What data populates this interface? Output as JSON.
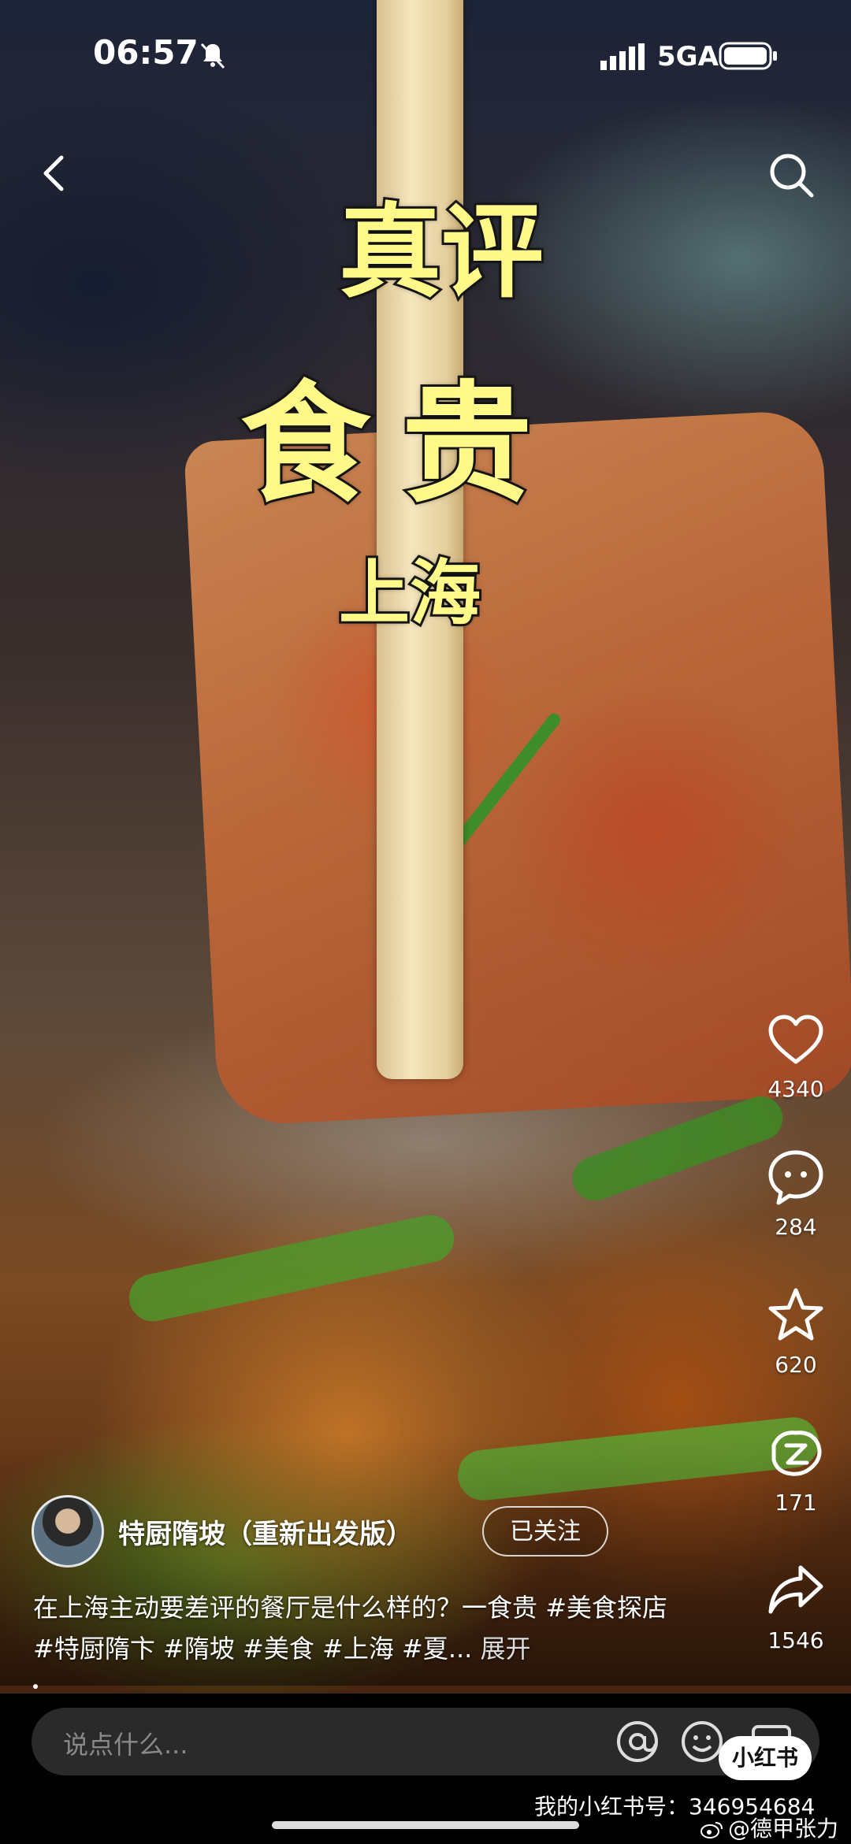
{
  "status_bar": {
    "time": "06:57",
    "network": "5GA",
    "icons": [
      "mute-bell-icon",
      "signal-icon",
      "battery-icon"
    ]
  },
  "nav": {
    "icons": [
      "back-chevron-icon",
      "search-icon"
    ]
  },
  "cover_title": {
    "line1": "真评",
    "line2": "食贵",
    "line3": "上海"
  },
  "actions": {
    "like_count": "4340",
    "comment_count": "284",
    "collect_count": "620",
    "special_count": "171",
    "share_count": "1546"
  },
  "author": {
    "name": "特厨隋坡（重新出发版）",
    "follow_label": "已关注"
  },
  "caption": {
    "text": "在上海主动要差评的餐厅是什么样的？一食贵",
    "tags": [
      "#美食探店",
      "#特厨隋卞",
      "#隋坡",
      "#美食",
      "#上海",
      "#夏..."
    ],
    "expand_label": "展开"
  },
  "comment_bar": {
    "placeholder": "说点什么..."
  },
  "watermarks": {
    "app_badge": "小红书",
    "id_line": "我的小红书号：346954684",
    "weibo_line": "@德甲张力"
  },
  "colors": {
    "title_fill": "#fff98a",
    "title_stroke": "#1a1a1a",
    "input_bg": "#2a2a2a"
  }
}
